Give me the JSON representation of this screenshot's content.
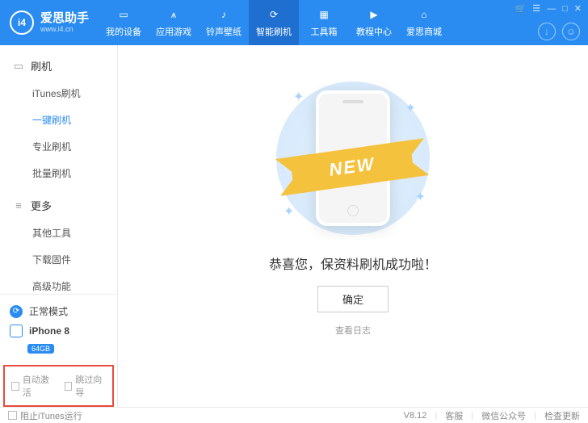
{
  "app": {
    "name_cn": "爱思助手",
    "name_en": "www.i4.cn",
    "logo_text": "i4"
  },
  "nav": [
    {
      "label": "我的设备"
    },
    {
      "label": "应用游戏"
    },
    {
      "label": "铃声壁纸"
    },
    {
      "label": "智能刷机",
      "active": true
    },
    {
      "label": "工具箱"
    },
    {
      "label": "教程中心"
    },
    {
      "label": "爱思商城"
    }
  ],
  "sidebar": {
    "group1": {
      "title": "刷机",
      "items": [
        "iTunes刷机",
        "一键刷机",
        "专业刷机",
        "批量刷机"
      ],
      "activeIndex": 1
    },
    "group2": {
      "title": "更多",
      "items": [
        "其他工具",
        "下载固件",
        "高级功能"
      ]
    }
  },
  "device": {
    "mode": "正常模式",
    "name": "iPhone 8",
    "storage": "64GB"
  },
  "options": {
    "auto_activate": "自动激活",
    "skip_guide": "跳过向导",
    "block_itunes": "阻止iTunes运行"
  },
  "main": {
    "ribbon": "NEW",
    "success_msg": "恭喜您，保资料刷机成功啦！",
    "ok": "确定",
    "view_log": "查看日志"
  },
  "footer": {
    "version": "V8.12",
    "support": "客服",
    "wechat": "微信公众号",
    "update": "检查更新"
  }
}
